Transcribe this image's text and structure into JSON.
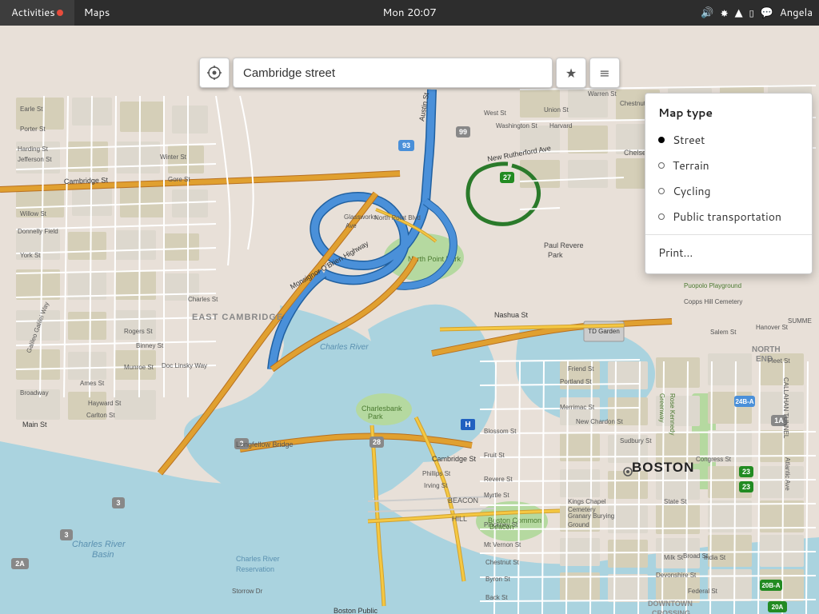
{
  "topbar": {
    "activities_label": "Activities",
    "app_name": "Maps",
    "clock": "Mon 20:07",
    "user_name": "Angela",
    "volume_icon": "🔊",
    "bluetooth_icon": "🔷",
    "wifi_icon": "📶",
    "battery_icon": "🔋",
    "chat_icon": "💬"
  },
  "search": {
    "placeholder": "Cambridge street",
    "value": "Cambridge street"
  },
  "map_type_panel": {
    "title": "Map type",
    "options": [
      {
        "label": "Street",
        "selected": true
      },
      {
        "label": "Terrain",
        "selected": false
      },
      {
        "label": "Cycling",
        "selected": false
      },
      {
        "label": "Public transportation",
        "selected": false
      }
    ],
    "print_label": "Print..."
  },
  "toolbar": {
    "star_symbol": "★",
    "menu_symbol": "≡",
    "location_symbol": "⊕"
  }
}
